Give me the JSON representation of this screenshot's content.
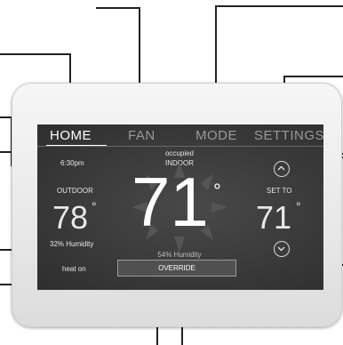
{
  "tabs": [
    {
      "label": "HOME",
      "active": true
    },
    {
      "label": "FAN",
      "active": false
    },
    {
      "label": "MODE",
      "active": false
    },
    {
      "label": "SETTINGS",
      "active": false
    }
  ],
  "status": {
    "time": "6:30pm",
    "occupancy": "occupied",
    "location": "INDOOR",
    "indoor_temp": "71",
    "indoor_unit": "°",
    "indoor_humidity": "54% Humidity"
  },
  "outdoor": {
    "label": "OUTDOOR",
    "temp": "78",
    "unit": "°",
    "humidity": "32% Humidity"
  },
  "system": {
    "state": "heat on"
  },
  "setpoint": {
    "label": "SET TO",
    "value": "71",
    "unit": "°"
  },
  "override": {
    "label": "OVERRIDE"
  },
  "icons": {
    "up": "chevron-up-icon",
    "down": "chevron-down-icon",
    "sun": "sun-rays-icon"
  },
  "colors": {
    "screen_bg": "#3a3a3a",
    "bezel": "#ececec",
    "text": "#ffffff",
    "inactive_tab": "#9a9a9a"
  }
}
